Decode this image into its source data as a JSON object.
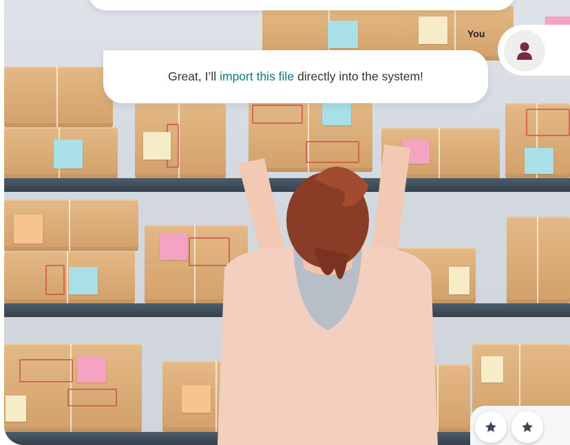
{
  "chat": {
    "sender": "You",
    "message_before": "Great, I’ll",
    "message_highlight": "import this file",
    "message_after": "directly into the system!"
  },
  "colors": {
    "accent": "#0a7a80",
    "avatar_icon": "#7a2a48",
    "star_icon": "#3a4756"
  },
  "icons": {
    "avatar": "user-icon",
    "rating": [
      "star-icon",
      "star-icon"
    ]
  }
}
